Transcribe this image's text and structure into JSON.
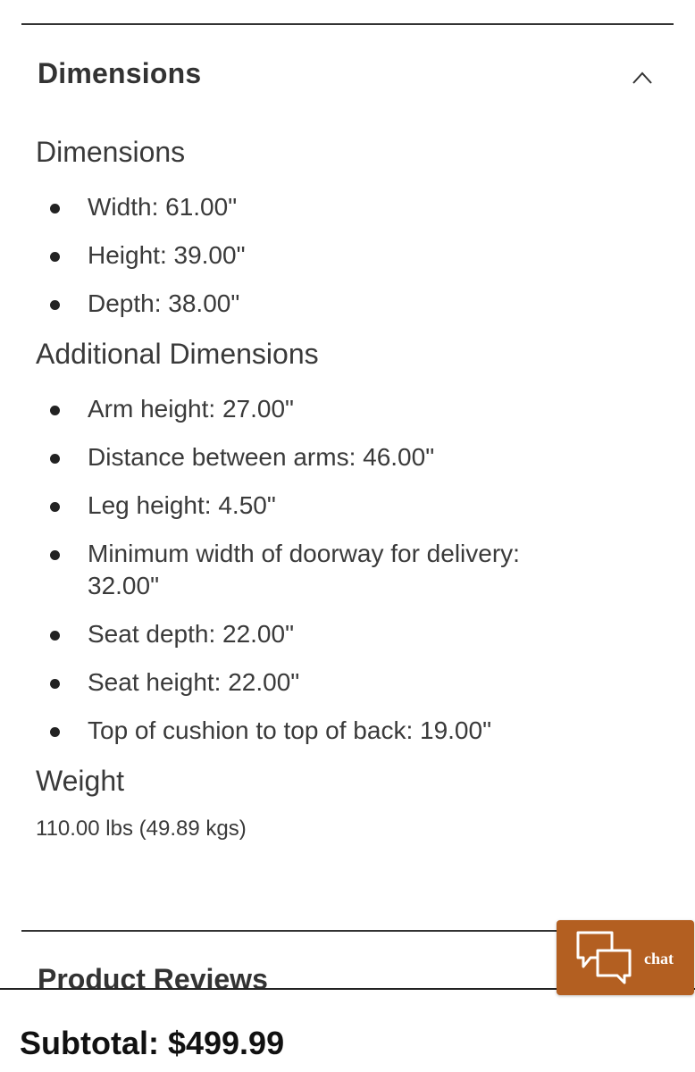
{
  "section": {
    "title": "Dimensions",
    "toggle_icon": "chevron-up-icon"
  },
  "dimensions": {
    "heading": "Dimensions",
    "items": [
      "Width: 61.00\"",
      "Height: 39.00\"",
      "Depth: 38.00\""
    ]
  },
  "additional": {
    "heading": "Additional Dimensions",
    "items": [
      "Arm height: 27.00\"",
      "Distance between arms: 46.00\"",
      "Leg height: 4.50\"",
      "Minimum width of doorway for delivery: 32.00\"",
      "Seat depth: 22.00\"",
      "Seat height: 22.00\"",
      "Top of cushion to top of back: 19.00\""
    ]
  },
  "weight": {
    "heading": "Weight",
    "value": "110.00 lbs (49.89 kgs)"
  },
  "reviews": {
    "title": "Product Reviews"
  },
  "subtotal": {
    "text": "Subtotal: $499.99"
  },
  "chat": {
    "label": "chat",
    "icon": "chat-bubbles-icon",
    "color": "#b35f21"
  }
}
